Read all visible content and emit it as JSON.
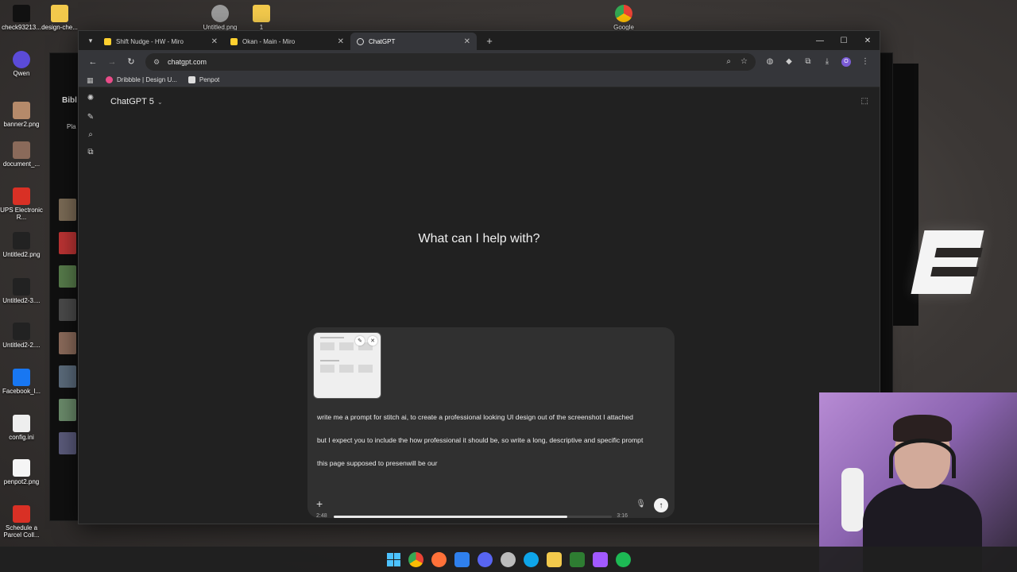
{
  "desktop": {
    "icons": [
      {
        "label": "check93213...",
        "color": "#111111"
      },
      {
        "label": "design-che...",
        "color": "#f2c94c"
      },
      {
        "label": "Untitled.png",
        "color": "#9a9a9a"
      },
      {
        "label": "1",
        "color": "#f2c94c"
      },
      {
        "label": "Google",
        "color": "#4285f4"
      },
      {
        "label": "Qwen",
        "color": "#5b4bd8"
      },
      {
        "label": "banner2.png",
        "color": "#b58a6a"
      },
      {
        "label": "document_...",
        "color": "#8a6a5a"
      },
      {
        "label": "UPS Electronic R...",
        "color": "#d93025"
      },
      {
        "label": "Untitled2.png",
        "color": "#222222"
      },
      {
        "label": "Untitled2-3....",
        "color": "#222222"
      },
      {
        "label": "Untitled2-2....",
        "color": "#222222"
      },
      {
        "label": "Facebook_l...",
        "color": "#1877f2"
      },
      {
        "label": "config.ini",
        "color": "#eeeeee"
      },
      {
        "label": "penpot2.png",
        "color": "#f5f5f5"
      },
      {
        "label": "Schedule a Parcel Coll...",
        "color": "#d93025"
      }
    ],
    "bg_window_labels": {
      "bibl": "Bibl",
      "pla": "Pla"
    }
  },
  "browser": {
    "tabs": [
      {
        "title": "Shift Nudge - HW - Miro",
        "favicon": "miro"
      },
      {
        "title": "Okan - Main - Miro",
        "favicon": "miro"
      },
      {
        "title": "ChatGPT",
        "favicon": "gpt",
        "active": true
      }
    ],
    "url": "chatgpt.com",
    "bookmarks": [
      {
        "label": "Dribbble | Design U...",
        "color": "#ea4c89"
      },
      {
        "label": "Penpot",
        "color": "#dddddd"
      }
    ],
    "profile_initial": "O"
  },
  "chatgpt": {
    "model": "ChatGPT 5",
    "heading": "What can I help with?",
    "attachment_alt": "screenshot attachment",
    "prompt_paragraphs": [
      "write me a prompt for stitch ai, to create a professional looking UI design out of the screenshot I attached",
      "but I expect you to include the how professional it should be, so write a long, descriptive and specific prompt",
      "this page supposed to presenwill be our"
    ]
  },
  "video_scrubber": {
    "elapsed": "2:48",
    "total": "3:16",
    "progress": 0.84
  },
  "colors": {
    "accent_purple": "#8b64b0",
    "miro_yellow": "#ffd02f"
  }
}
